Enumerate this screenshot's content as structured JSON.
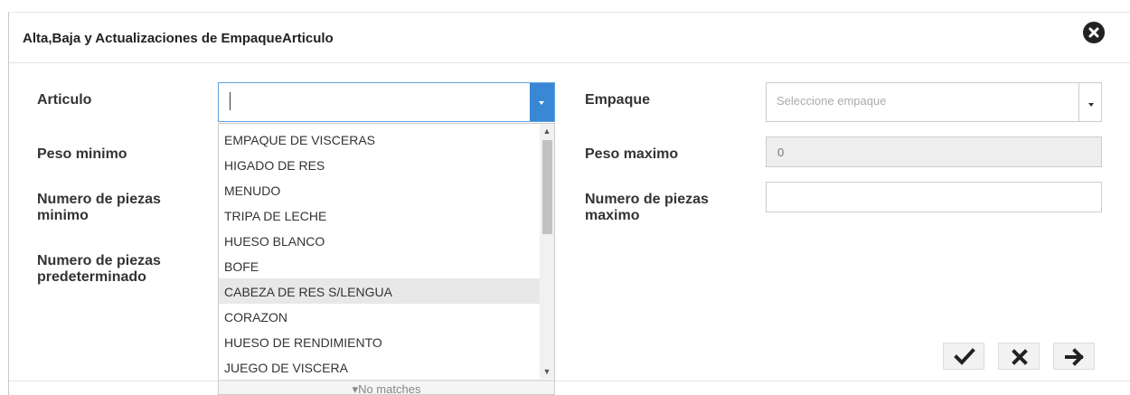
{
  "dialog": {
    "title": "Alta,Baja y Actualizaciones de EmpaqueArticulo"
  },
  "form": {
    "articulo_label": "Articulo",
    "empaque_label": "Empaque",
    "empaque_placeholder": "Seleccione empaque",
    "peso_minimo_label": "Peso minimo",
    "peso_maximo_label": "Peso maximo",
    "peso_maximo_value": "0",
    "num_piezas_minimo_label_1": "Numero de piezas",
    "num_piezas_minimo_label_2": "minimo",
    "num_piezas_maximo_label_1": "Numero de piezas",
    "num_piezas_maximo_label_2": "maximo",
    "num_piezas_predet_label_1": "Numero de piezas",
    "num_piezas_predet_label_2": "predeterminado"
  },
  "dropdown": {
    "items": [
      "EMPAQUE DE VISCERAS",
      "HIGADO DE RES",
      "MENUDO",
      "TRIPA DE LECHE",
      "HUESO BLANCO",
      "BOFE",
      "CABEZA DE RES S/LENGUA",
      "CORAZON",
      "HUESO DE RENDIMIENTO",
      "JUEGO DE VISCERA"
    ],
    "highlighted_index": 6,
    "no_matches": "No matches",
    "no_matches_arrow": "▾"
  },
  "icons": {
    "close": "close-circle-icon",
    "confirm": "checkmark-icon",
    "cancel": "x-icon",
    "next": "arrow-right-icon"
  },
  "colors": {
    "accent": "#3a87d6",
    "focus_border": "#5fa2dd",
    "highlight": "#e8e8e8"
  }
}
